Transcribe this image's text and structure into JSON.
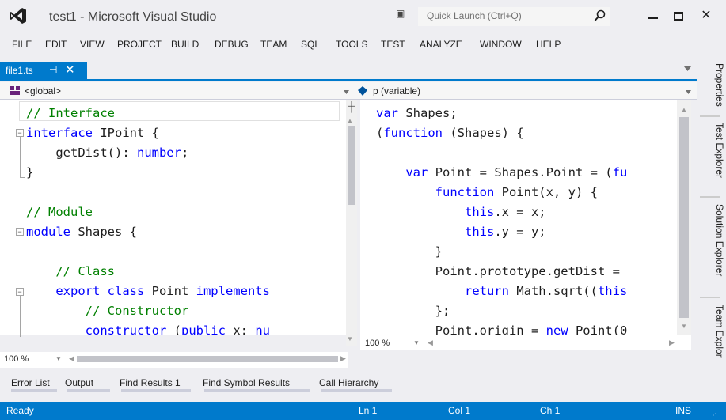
{
  "window": {
    "title": "test1 - Microsoft Visual Studio",
    "quick_launch_placeholder": "Quick Launch (Ctrl+Q)"
  },
  "menu": [
    "FILE",
    "EDIT",
    "VIEW",
    "PROJECT",
    "BUILD",
    "DEBUG",
    "TEAM",
    "SQL",
    "TOOLS",
    "TEST",
    "ANALYZE",
    "WINDOW",
    "HELP"
  ],
  "tab": {
    "label": "file1.ts",
    "pin": "⊣",
    "close": "✕"
  },
  "nav": {
    "left": "<global>",
    "right": "p (variable)"
  },
  "left_code": [
    [
      {
        "t": "// Interface",
        "c": "cm"
      }
    ],
    [
      {
        "t": "interface",
        "c": "kw"
      },
      {
        "t": " IPoint {"
      }
    ],
    [
      {
        "t": "    getDist(): "
      },
      {
        "t": "number",
        "c": "kw"
      },
      {
        "t": ";"
      }
    ],
    [
      {
        "t": "}"
      }
    ],
    [
      {
        "t": ""
      }
    ],
    [
      {
        "t": "// Module",
        "c": "cm"
      }
    ],
    [
      {
        "t": "module",
        "c": "kw"
      },
      {
        "t": " Shapes {"
      }
    ],
    [
      {
        "t": ""
      }
    ],
    [
      {
        "t": "    "
      },
      {
        "t": "// Class",
        "c": "cm"
      }
    ],
    [
      {
        "t": "    "
      },
      {
        "t": "export class",
        "c": "kw"
      },
      {
        "t": " Point "
      },
      {
        "t": "implements",
        "c": "kw"
      }
    ],
    [
      {
        "t": "        "
      },
      {
        "t": "// Constructor",
        "c": "cm"
      }
    ],
    [
      {
        "t": "        "
      },
      {
        "t": "constructor",
        "c": "kw"
      },
      {
        "t": " ("
      },
      {
        "t": "public",
        "c": "kw"
      },
      {
        "t": " x: "
      },
      {
        "t": "nu",
        "c": "kw"
      }
    ]
  ],
  "right_code": [
    [
      {
        "t": "var",
        "c": "kw"
      },
      {
        "t": " Shapes;"
      }
    ],
    [
      {
        "t": "("
      },
      {
        "t": "function",
        "c": "kw"
      },
      {
        "t": " (Shapes) {"
      }
    ],
    [
      {
        "t": ""
      }
    ],
    [
      {
        "t": "    "
      },
      {
        "t": "var",
        "c": "kw"
      },
      {
        "t": " Point = Shapes.Point = ("
      },
      {
        "t": "fu",
        "c": "kw"
      }
    ],
    [
      {
        "t": "        "
      },
      {
        "t": "function",
        "c": "kw"
      },
      {
        "t": " Point(x, y) {"
      }
    ],
    [
      {
        "t": "            "
      },
      {
        "t": "this",
        "c": "kw"
      },
      {
        "t": ".x = x;"
      }
    ],
    [
      {
        "t": "            "
      },
      {
        "t": "this",
        "c": "kw"
      },
      {
        "t": ".y = y;"
      }
    ],
    [
      {
        "t": "        }"
      }
    ],
    [
      {
        "t": "        Point.prototype.getDist = "
      }
    ],
    [
      {
        "t": "            "
      },
      {
        "t": "return",
        "c": "kw"
      },
      {
        "t": " Math.sqrt(("
      },
      {
        "t": "this",
        "c": "kw"
      }
    ],
    [
      {
        "t": "        };"
      }
    ],
    [
      {
        "t": "        Point.origin = "
      },
      {
        "t": "new",
        "c": "kw"
      },
      {
        "t": " Point(0"
      }
    ]
  ],
  "zoom": {
    "left": "100 %",
    "right": "100 %"
  },
  "sidebar": [
    "Properties",
    "Test Explorer",
    "Solution Explorer",
    "Team Explor"
  ],
  "bottom_tabs": [
    "Error List",
    "Output",
    "Find Results 1",
    "Find Symbol Results",
    "Call Hierarchy"
  ],
  "status": {
    "ready": "Ready",
    "ln": "Ln 1",
    "col": "Col 1",
    "ch": "Ch 1",
    "ins": "INS"
  },
  "colors": {
    "accent": "#007acc",
    "keyword": "#0000ff",
    "comment": "#008000"
  }
}
